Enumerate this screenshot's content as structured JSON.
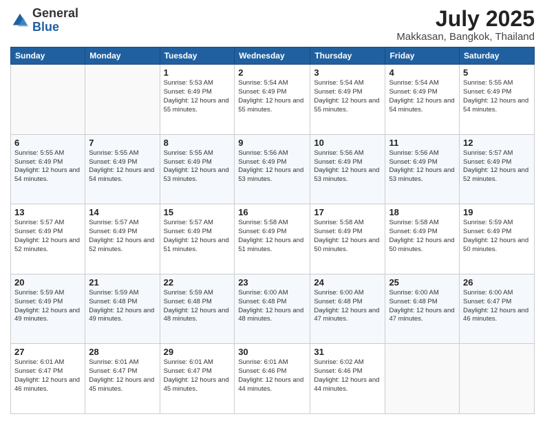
{
  "logo": {
    "general": "General",
    "blue": "Blue"
  },
  "header": {
    "month_year": "July 2025",
    "location": "Makkasan, Bangkok, Thailand"
  },
  "weekdays": [
    "Sunday",
    "Monday",
    "Tuesday",
    "Wednesday",
    "Thursday",
    "Friday",
    "Saturday"
  ],
  "weeks": [
    [
      {
        "day": "",
        "sunrise": "",
        "sunset": "",
        "daylight": ""
      },
      {
        "day": "",
        "sunrise": "",
        "sunset": "",
        "daylight": ""
      },
      {
        "day": "1",
        "sunrise": "Sunrise: 5:53 AM",
        "sunset": "Sunset: 6:49 PM",
        "daylight": "Daylight: 12 hours and 55 minutes."
      },
      {
        "day": "2",
        "sunrise": "Sunrise: 5:54 AM",
        "sunset": "Sunset: 6:49 PM",
        "daylight": "Daylight: 12 hours and 55 minutes."
      },
      {
        "day": "3",
        "sunrise": "Sunrise: 5:54 AM",
        "sunset": "Sunset: 6:49 PM",
        "daylight": "Daylight: 12 hours and 55 minutes."
      },
      {
        "day": "4",
        "sunrise": "Sunrise: 5:54 AM",
        "sunset": "Sunset: 6:49 PM",
        "daylight": "Daylight: 12 hours and 54 minutes."
      },
      {
        "day": "5",
        "sunrise": "Sunrise: 5:55 AM",
        "sunset": "Sunset: 6:49 PM",
        "daylight": "Daylight: 12 hours and 54 minutes."
      }
    ],
    [
      {
        "day": "6",
        "sunrise": "Sunrise: 5:55 AM",
        "sunset": "Sunset: 6:49 PM",
        "daylight": "Daylight: 12 hours and 54 minutes."
      },
      {
        "day": "7",
        "sunrise": "Sunrise: 5:55 AM",
        "sunset": "Sunset: 6:49 PM",
        "daylight": "Daylight: 12 hours and 54 minutes."
      },
      {
        "day": "8",
        "sunrise": "Sunrise: 5:55 AM",
        "sunset": "Sunset: 6:49 PM",
        "daylight": "Daylight: 12 hours and 53 minutes."
      },
      {
        "day": "9",
        "sunrise": "Sunrise: 5:56 AM",
        "sunset": "Sunset: 6:49 PM",
        "daylight": "Daylight: 12 hours and 53 minutes."
      },
      {
        "day": "10",
        "sunrise": "Sunrise: 5:56 AM",
        "sunset": "Sunset: 6:49 PM",
        "daylight": "Daylight: 12 hours and 53 minutes."
      },
      {
        "day": "11",
        "sunrise": "Sunrise: 5:56 AM",
        "sunset": "Sunset: 6:49 PM",
        "daylight": "Daylight: 12 hours and 53 minutes."
      },
      {
        "day": "12",
        "sunrise": "Sunrise: 5:57 AM",
        "sunset": "Sunset: 6:49 PM",
        "daylight": "Daylight: 12 hours and 52 minutes."
      }
    ],
    [
      {
        "day": "13",
        "sunrise": "Sunrise: 5:57 AM",
        "sunset": "Sunset: 6:49 PM",
        "daylight": "Daylight: 12 hours and 52 minutes."
      },
      {
        "day": "14",
        "sunrise": "Sunrise: 5:57 AM",
        "sunset": "Sunset: 6:49 PM",
        "daylight": "Daylight: 12 hours and 52 minutes."
      },
      {
        "day": "15",
        "sunrise": "Sunrise: 5:57 AM",
        "sunset": "Sunset: 6:49 PM",
        "daylight": "Daylight: 12 hours and 51 minutes."
      },
      {
        "day": "16",
        "sunrise": "Sunrise: 5:58 AM",
        "sunset": "Sunset: 6:49 PM",
        "daylight": "Daylight: 12 hours and 51 minutes."
      },
      {
        "day": "17",
        "sunrise": "Sunrise: 5:58 AM",
        "sunset": "Sunset: 6:49 PM",
        "daylight": "Daylight: 12 hours and 50 minutes."
      },
      {
        "day": "18",
        "sunrise": "Sunrise: 5:58 AM",
        "sunset": "Sunset: 6:49 PM",
        "daylight": "Daylight: 12 hours and 50 minutes."
      },
      {
        "day": "19",
        "sunrise": "Sunrise: 5:59 AM",
        "sunset": "Sunset: 6:49 PM",
        "daylight": "Daylight: 12 hours and 50 minutes."
      }
    ],
    [
      {
        "day": "20",
        "sunrise": "Sunrise: 5:59 AM",
        "sunset": "Sunset: 6:49 PM",
        "daylight": "Daylight: 12 hours and 49 minutes."
      },
      {
        "day": "21",
        "sunrise": "Sunrise: 5:59 AM",
        "sunset": "Sunset: 6:48 PM",
        "daylight": "Daylight: 12 hours and 49 minutes."
      },
      {
        "day": "22",
        "sunrise": "Sunrise: 5:59 AM",
        "sunset": "Sunset: 6:48 PM",
        "daylight": "Daylight: 12 hours and 48 minutes."
      },
      {
        "day": "23",
        "sunrise": "Sunrise: 6:00 AM",
        "sunset": "Sunset: 6:48 PM",
        "daylight": "Daylight: 12 hours and 48 minutes."
      },
      {
        "day": "24",
        "sunrise": "Sunrise: 6:00 AM",
        "sunset": "Sunset: 6:48 PM",
        "daylight": "Daylight: 12 hours and 47 minutes."
      },
      {
        "day": "25",
        "sunrise": "Sunrise: 6:00 AM",
        "sunset": "Sunset: 6:48 PM",
        "daylight": "Daylight: 12 hours and 47 minutes."
      },
      {
        "day": "26",
        "sunrise": "Sunrise: 6:00 AM",
        "sunset": "Sunset: 6:47 PM",
        "daylight": "Daylight: 12 hours and 46 minutes."
      }
    ],
    [
      {
        "day": "27",
        "sunrise": "Sunrise: 6:01 AM",
        "sunset": "Sunset: 6:47 PM",
        "daylight": "Daylight: 12 hours and 46 minutes."
      },
      {
        "day": "28",
        "sunrise": "Sunrise: 6:01 AM",
        "sunset": "Sunset: 6:47 PM",
        "daylight": "Daylight: 12 hours and 45 minutes."
      },
      {
        "day": "29",
        "sunrise": "Sunrise: 6:01 AM",
        "sunset": "Sunset: 6:47 PM",
        "daylight": "Daylight: 12 hours and 45 minutes."
      },
      {
        "day": "30",
        "sunrise": "Sunrise: 6:01 AM",
        "sunset": "Sunset: 6:46 PM",
        "daylight": "Daylight: 12 hours and 44 minutes."
      },
      {
        "day": "31",
        "sunrise": "Sunrise: 6:02 AM",
        "sunset": "Sunset: 6:46 PM",
        "daylight": "Daylight: 12 hours and 44 minutes."
      },
      {
        "day": "",
        "sunrise": "",
        "sunset": "",
        "daylight": ""
      },
      {
        "day": "",
        "sunrise": "",
        "sunset": "",
        "daylight": ""
      }
    ]
  ]
}
